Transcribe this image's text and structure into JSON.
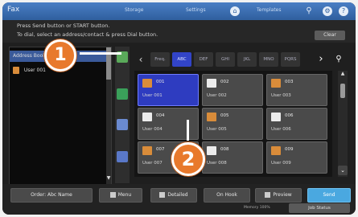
{
  "header": {
    "title": "Fax",
    "links": [
      "Storage",
      "Settings",
      "Templates"
    ],
    "icon_names": [
      "home-icon",
      "search-icon",
      "gear-icon",
      "help-icon"
    ]
  },
  "message": {
    "line1": "Press Send button or START button.",
    "line2": "To dial, select an address/contact & press Dial button."
  },
  "clear_label": "Clear",
  "address_list": {
    "rows": [
      {
        "label": "Address Book"
      },
      {
        "label": "User 001"
      }
    ]
  },
  "tabs": {
    "items": [
      "ABC",
      "DEF",
      "GHI",
      "JKL",
      "MNO",
      "PQRS"
    ],
    "first": "Freq.",
    "active_index": 0
  },
  "tiles": [
    {
      "name": "001",
      "sub": "User 001",
      "selected": true,
      "icon": "person"
    },
    {
      "name": "002",
      "sub": "User 002",
      "selected": false,
      "icon": "fax"
    },
    {
      "name": "003",
      "sub": "User 003",
      "selected": false,
      "icon": "person"
    },
    {
      "name": "004",
      "sub": "User 004",
      "selected": false,
      "icon": "fax"
    },
    {
      "name": "005",
      "sub": "User 005",
      "selected": false,
      "icon": "person"
    },
    {
      "name": "006",
      "sub": "User 006",
      "selected": false,
      "icon": "fax"
    },
    {
      "name": "007",
      "sub": "User 007",
      "selected": false,
      "icon": "fax"
    },
    {
      "name": "008",
      "sub": "User 008",
      "selected": false,
      "icon": "fax"
    },
    {
      "name": "009",
      "sub": "User 009",
      "selected": false,
      "icon": "person"
    }
  ],
  "bottom": {
    "buttons": [
      "Order: Abc Name",
      "Menu",
      "Detailed",
      "On Hook",
      "Preview",
      "Send"
    ],
    "memory": "Memory 100%",
    "job_status": "Job Status"
  },
  "callouts": [
    "1",
    "2"
  ],
  "colors": {
    "header": "#3b6eb5",
    "selected_tile": "#2e3cc0",
    "send_button": "#4aa8e0",
    "callout": "#e8792c"
  }
}
